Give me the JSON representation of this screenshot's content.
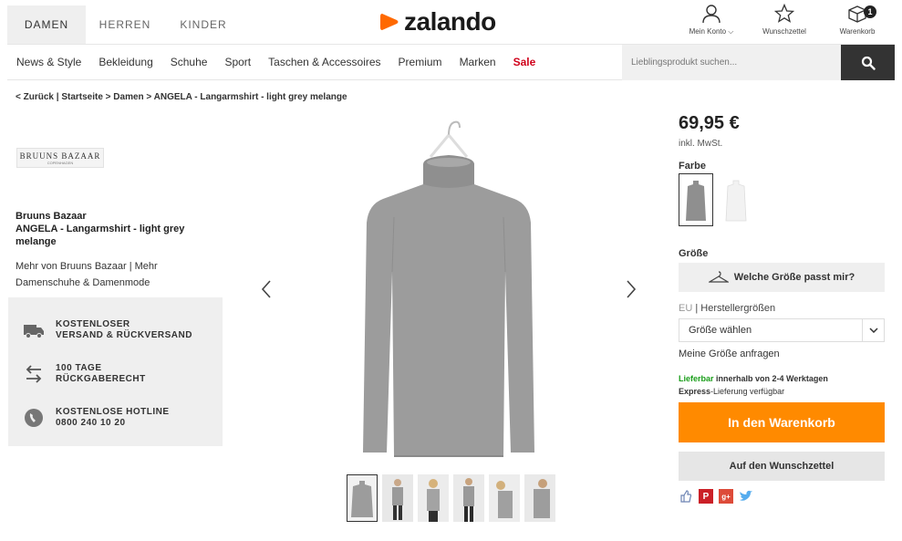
{
  "header": {
    "gender_tabs": [
      {
        "label": "DAMEN",
        "active": true
      },
      {
        "label": "HERREN",
        "active": false
      },
      {
        "label": "KINDER",
        "active": false
      }
    ],
    "logo_text": "zalando",
    "logo_color": "#ff6900",
    "account_label": "Mein Konto ⌵",
    "wishlist_label": "Wunschzettel",
    "cart_label": "Warenkorb",
    "cart_count": "1"
  },
  "nav": {
    "categories": [
      "News & Style",
      "Bekleidung",
      "Schuhe",
      "Sport",
      "Taschen & Accessoires",
      "Premium",
      "Marken"
    ],
    "sale_label": "Sale",
    "search_placeholder": "Lieblingsprodukt suchen..."
  },
  "breadcrumb": "< Zurück | Startseite > Damen > ANGELA - Langarmshirt - light grey melange",
  "brand": {
    "logo_name": "BRUUNS BAZAAR",
    "logo_sub": "COPENHAGEN",
    "name": "Bruuns Bazaar",
    "product_name": "ANGELA - Langarmshirt - light grey melange",
    "more_links": "Mehr von Bruuns Bazaar | Mehr Damenschuhe & Damenmode"
  },
  "services": [
    {
      "icon": "truck-icon",
      "line1": "KOSTENLOSER",
      "line2": "VERSAND & RÜCKVERSAND"
    },
    {
      "icon": "return-arrow-icon",
      "line1": "100 TAGE",
      "line2": "RÜCKGABERECHT"
    },
    {
      "icon": "phone-icon",
      "line1": "KOSTENLOSE HOTLINE",
      "line2": "0800 240 10 20"
    }
  ],
  "product": {
    "price": "69,95 €",
    "vat": "inkl. MwSt.",
    "color_label": "Farbe",
    "size_label": "Größe",
    "size_help": "Welche Größe passt mir?",
    "size_system_eu": "EU",
    "size_system_rest": " | Herstellergrößen",
    "size_select": "Größe wählen",
    "size_request": "Meine Größe anfragen",
    "delivery_green": "Lieferbar",
    "delivery_line1_rest": " innerhalb von 2-4 Werktagen",
    "delivery_line2_bold": "Express",
    "delivery_line2_rest": "-Lieferung verfügbar",
    "add_to_cart": "In den Warenkorb",
    "add_to_wishlist": "Auf den Wunschzettel",
    "cart_button_color": "#ff8a00",
    "sweater_color": "#9c9c9c"
  }
}
